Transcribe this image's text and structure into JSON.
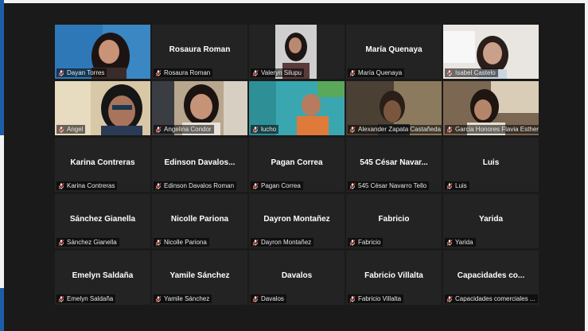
{
  "participants": [
    {
      "name": "Dayan Torres",
      "video": "video-dayan",
      "active": true
    },
    {
      "name": "Rosaura Roman",
      "center": "Rosaura Roman"
    },
    {
      "name": "Valeryn Silupu",
      "video": "video-valeryn"
    },
    {
      "name": "María Quenaya",
      "center": "María Quenaya"
    },
    {
      "name": "Isabel Castelo",
      "video": "video-isabel"
    },
    {
      "name": "Angel",
      "video": "video-angel"
    },
    {
      "name": "Angelina Condor",
      "video": "video-angelina"
    },
    {
      "name": "lucho",
      "video": "video-lucho"
    },
    {
      "name": "Alexander Zapata Castañeda",
      "video": "video-alexander"
    },
    {
      "name": "Garcia Honores Flavia Esther",
      "video": "video-garcia"
    },
    {
      "name": "Karina Contreras",
      "center": "Karina Contreras"
    },
    {
      "name": "Edinson Davalos Roman",
      "center": "Edinson  Davalos..."
    },
    {
      "name": "Pagan Correa",
      "center": "Pagan Correa"
    },
    {
      "name": "545 César Navarro Tello",
      "center": "545  César  Navar..."
    },
    {
      "name": "Luis",
      "center": "Luis"
    },
    {
      "name": "Sánchez Gianella",
      "center": "Sánchez Gianella"
    },
    {
      "name": "Nicolle Pariona",
      "center": "Nicolle Pariona"
    },
    {
      "name": "Dayron Montañez",
      "center": "Dayron Montañez"
    },
    {
      "name": "Fabricio",
      "center": "Fabricio"
    },
    {
      "name": "Yarida",
      "center": "Yarida"
    },
    {
      "name": "Emelyn Saldaña",
      "center": "Emelyn Saldaña"
    },
    {
      "name": "Yamile Sánchez",
      "center": "Yamile Sánchez"
    },
    {
      "name": "Davalos",
      "center": "Davalos"
    },
    {
      "name": "Fabricio Villalta",
      "center": "Fabricio Villalta"
    },
    {
      "name": "Capacidades comerciales ...",
      "center": "Capacidades   co..."
    }
  ],
  "colors": {
    "active_border": "#c6e84a",
    "muted_mic": "#e0463a"
  }
}
